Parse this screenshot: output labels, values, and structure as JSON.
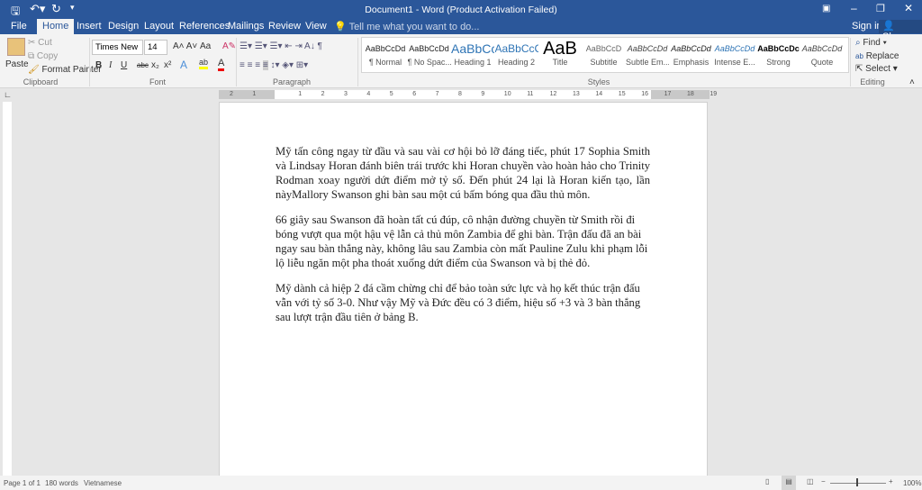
{
  "title": "Document1 - Word (Product Activation Failed)",
  "qat": {
    "save": "save-icon",
    "undo": "undo-icon",
    "redo": "redo-icon"
  },
  "tabs": [
    "File",
    "Home",
    "Insert",
    "Design",
    "Layout",
    "References",
    "Mailings",
    "Review",
    "View"
  ],
  "tell_me": "Tell me what you want to do...",
  "sign_in": "Sign in",
  "share": "Share",
  "clipboard": {
    "paste": "Paste",
    "cut": "Cut",
    "copy": "Copy",
    "format_painter": "Format Painter",
    "label": "Clipboard"
  },
  "font": {
    "name": "Times New Ro",
    "size": "14",
    "label": "Font",
    "bold": "B",
    "italic": "I",
    "underline": "U",
    "strike": "abc",
    "sub": "x₂",
    "sup": "x²",
    "case": "Aa",
    "highlight_color": "#ffff00",
    "font_color": "#e00000"
  },
  "paragraph": {
    "label": "Paragraph",
    "pilcrow": "¶"
  },
  "styles": {
    "label": "Styles",
    "items": [
      {
        "preview": "AaBbCcDd",
        "name": "¶ Normal"
      },
      {
        "preview": "AaBbCcDd",
        "name": "¶ No Spac..."
      },
      {
        "preview": "AaBbCc",
        "name": "Heading 1"
      },
      {
        "preview": "AaBbCcC",
        "name": "Heading 2"
      },
      {
        "preview": "AaB",
        "name": "Title"
      },
      {
        "preview": "AaBbCcD",
        "name": "Subtitle"
      },
      {
        "preview": "AaBbCcDd",
        "name": "Subtle Em..."
      },
      {
        "preview": "AaBbCcDd",
        "name": "Emphasis"
      },
      {
        "preview": "AaBbCcDd",
        "name": "Intense E..."
      },
      {
        "preview": "AaBbCcDc",
        "name": "Strong"
      },
      {
        "preview": "AaBbCcDd",
        "name": "Quote"
      }
    ]
  },
  "editing": {
    "label": "Editing",
    "find": "Find",
    "replace": "Replace",
    "select": "Select"
  },
  "ruler_ticks": [
    "2",
    "1",
    "",
    "1",
    "2",
    "3",
    "4",
    "5",
    "6",
    "7",
    "8",
    "9",
    "10",
    "11",
    "12",
    "13",
    "14",
    "15",
    "16",
    "17",
    "18",
    "19"
  ],
  "document": {
    "paragraphs": [
      "Mỹ tấn công ngay từ đầu và sau vài cơ hội bỏ lỡ đáng tiếc, phút 17 Sophia Smith và Lindsay Horan đánh biên trái trước khi Horan chuyền vào hoàn hảo cho Trinity Rodman xoay người dứt điểm mở tỷ số. Đến phút 24 lại là Horan kiến tạo, lần nàyMallory Swanson ghi bàn sau một cú bấm bóng qua đầu thủ môn.",
      "66 giây sau Swanson đã hoàn tất cú đúp, cô nhận đường chuyền từ Smith rồi đi bóng vượt qua một hậu vệ lẫn cả thủ môn Zambia để ghi bàn. Trận đấu đã an bài ngay sau bàn thắng này, không lâu sau Zambia còn mất  Pauline Zulu khi phạm lỗi lộ liễu ngăn một pha thoát xuống dứt điểm của  Swanson và bị thẻ đỏ.",
      "Mỹ dành cả hiệp 2 đá cầm chừng chỉ để bảo toàn sức lực và họ kết thúc trận đấu vẫn với tỷ số 3-0. Như vậy Mỹ và Đức đều có 3 điểm, hiệu số +3 và 3 bàn thắng sau lượt trận đầu tiên ở bảng B."
    ]
  },
  "status": {
    "page": "Page 1 of 1",
    "words": "180 words",
    "language": "Vietnamese",
    "zoom": "100%"
  },
  "colors": {
    "brand": "#2b579a"
  }
}
